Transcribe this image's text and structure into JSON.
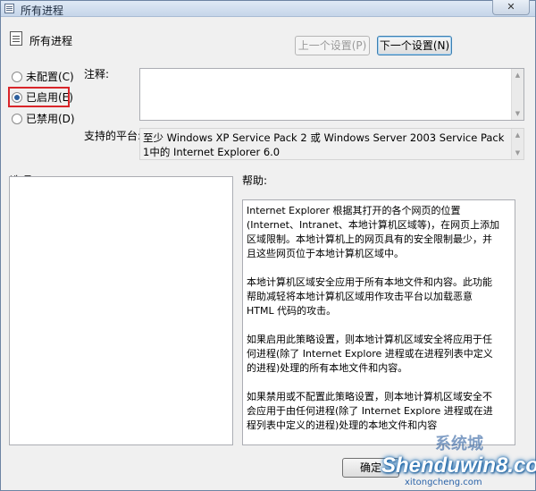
{
  "window": {
    "title": "所有进程",
    "close_glyph": "✕"
  },
  "header": {
    "title": "所有进程",
    "prev_button": "上一个设置(P)",
    "next_button": "下一个设置(N)"
  },
  "state_options": [
    {
      "label": "未配置(C)",
      "checked": false
    },
    {
      "label": "已启用(E)",
      "checked": true
    },
    {
      "label": "已禁用(D)",
      "checked": false
    }
  ],
  "comment": {
    "label": "注释:",
    "value": ""
  },
  "platform": {
    "label": "支持的平台:",
    "text": "至少 Windows XP Service Pack 2 或 Windows Server 2003 Service Pack 1中的 Internet Explorer 6.0"
  },
  "options": {
    "label": "选项:"
  },
  "help": {
    "label": "帮助:",
    "paragraphs": [
      "Internet Explorer 根据其打开的各个网页的位置(Internet、Intranet、本地计算机区域等)，在网页上添加区域限制。本地计算机上的网页具有的安全限制最少，并且这些网页位于本地计算机区域中。",
      "本地计算机区域安全应用于所有本地文件和内容。此功能帮助减轻将本地计算机区域用作攻击平台以加载恶意 HTML 代码的攻击。",
      "如果启用此策略设置，则本地计算机区域安全将应用于任何进程(除了 Internet Explore 进程或在进程列表中定义的进程)处理的所有本地文件和内容。",
      "如果禁用或不配置此策略设置，则本地计算机区域安全不会应用于由任何进程(除了 Internet Explore 进程或在进程列表中定义的进程)处理的本地文件和内容"
    ]
  },
  "footer": {
    "ok_button": "确定"
  },
  "watermark": {
    "brand": "Shenduwin8.com",
    "sub": "xitongcheng.com",
    "logo": "系统城"
  },
  "colors": {
    "highlight": "#d9252a",
    "titlebar": "#c5d5e9"
  }
}
